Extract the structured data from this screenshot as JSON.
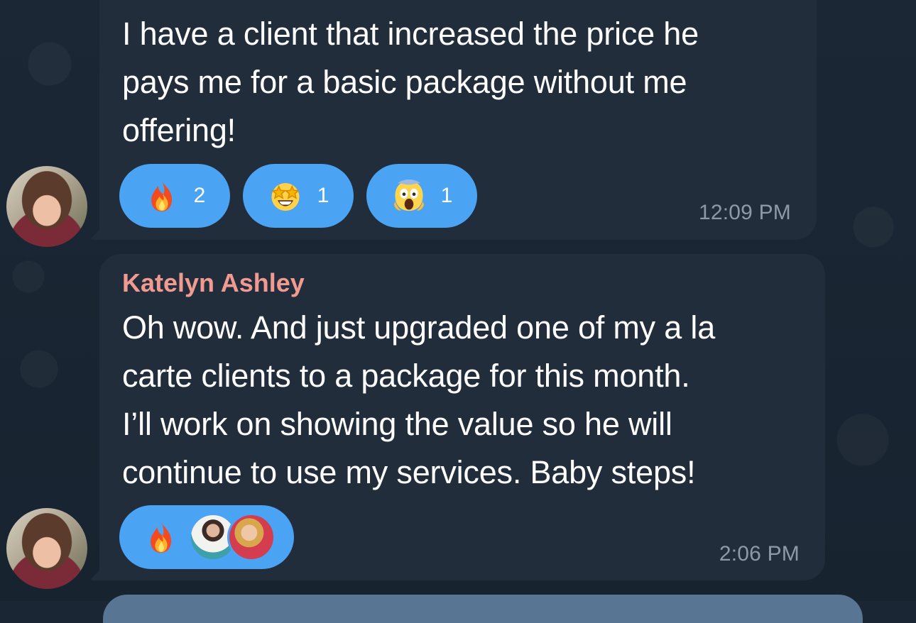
{
  "messages": [
    {
      "text": "I have a client that increased the price he\npays me for a basic package without me\noffering!",
      "reactions": [
        {
          "emoji": "fire-icon",
          "count": "2"
        },
        {
          "emoji": "star-struck-icon",
          "count": "1"
        },
        {
          "emoji": "face-screaming-icon",
          "count": "1"
        }
      ],
      "time": "12:09 PM"
    },
    {
      "sender": "Katelyn Ashley",
      "text": "Oh wow. And just upgraded one of my a la\ncarte clients to a package for this month.\nI’ll work on showing the value so he will\ncontinue to use my services. Baby steps!",
      "reactions": [
        {
          "emoji": "fire-icon",
          "reactors": [
            "reactor-avatar",
            "reactor-avatar"
          ]
        }
      ],
      "time": "2:06 PM"
    }
  ],
  "colors": {
    "background": "#1a2634",
    "bubble": "#212d3b",
    "reaction": "#4aa3f3",
    "sender_name": "#f09a91",
    "timestamp": "#9aa7b6"
  }
}
